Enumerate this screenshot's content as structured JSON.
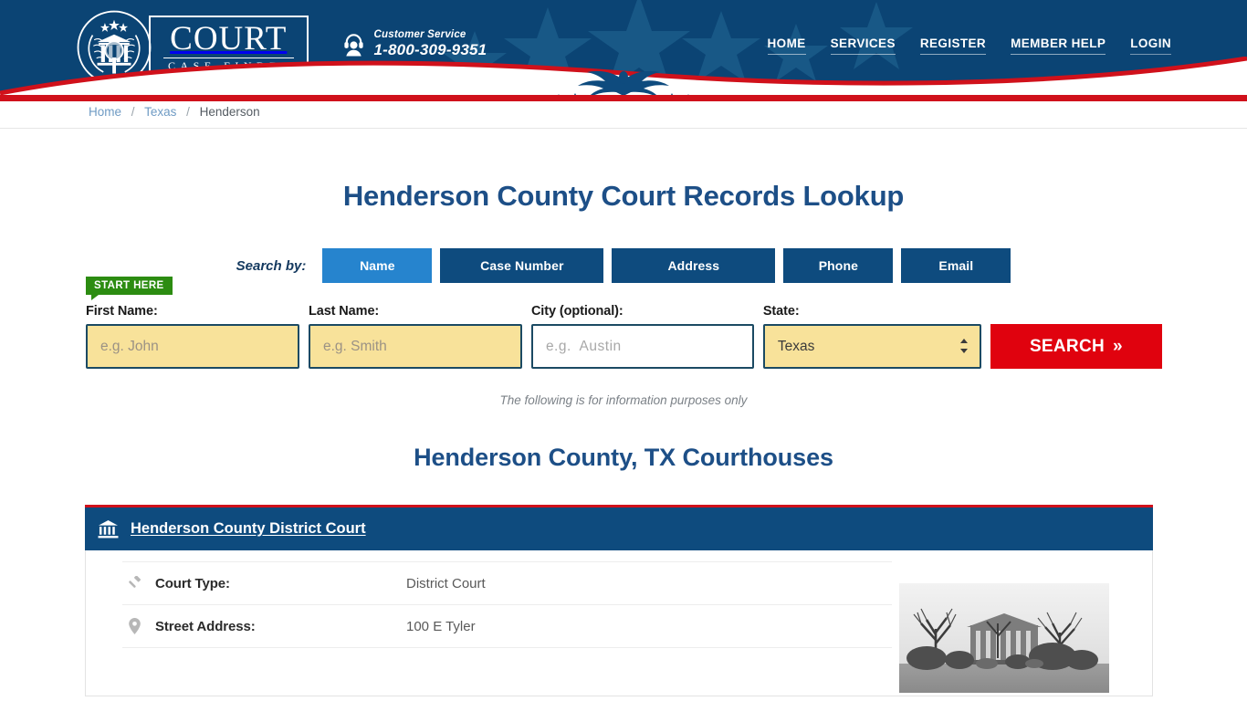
{
  "header": {
    "logo": {
      "word": "COURT",
      "sub": "CASE FINDER"
    },
    "customer_service": {
      "label": "Customer Service",
      "phone": "1-800-309-9351"
    },
    "nav": [
      {
        "label": "HOME"
      },
      {
        "label": "SERVICES"
      },
      {
        "label": "REGISTER"
      },
      {
        "label": "MEMBER HELP"
      },
      {
        "label": "LOGIN"
      }
    ],
    "colors": {
      "navy": "#0b4474",
      "red": "#d0111b",
      "white": "#ffffff"
    }
  },
  "breadcrumb": {
    "home": "Home",
    "state": "Texas",
    "current": "Henderson",
    "separator": "/"
  },
  "main": {
    "page_title": "Henderson County Court Records Lookup",
    "search_by_label": "Search by:",
    "tabs": [
      {
        "label": "Name",
        "active": true
      },
      {
        "label": "Case Number",
        "active": false
      },
      {
        "label": "Address",
        "active": false
      },
      {
        "label": "Phone",
        "active": false
      },
      {
        "label": "Email",
        "active": false
      }
    ],
    "start_badge": "START HERE",
    "form": {
      "first_name": {
        "label": "First Name:",
        "placeholder": "e.g. John",
        "value": ""
      },
      "last_name": {
        "label": "Last Name:",
        "placeholder": "e.g. Smith",
        "value": ""
      },
      "city": {
        "label": "City (optional):",
        "placeholder": "e.g.  Austin",
        "value": ""
      },
      "state": {
        "label": "State:",
        "value": "Texas"
      },
      "search_button": "SEARCH",
      "search_chevron": "»"
    },
    "disclaimer": "The following is for information purposes only",
    "section_title": "Henderson County, TX Courthouses",
    "court_card": {
      "name": "Henderson County District Court",
      "icon": "bank-icon",
      "rows": [
        {
          "icon": "gavel-icon",
          "label": "Court Type:",
          "value": "District Court"
        },
        {
          "icon": "map-pin-icon",
          "label": "Street Address:",
          "value": "100 E Tyler"
        }
      ],
      "photo_alt": "Henderson County courthouse photo"
    }
  }
}
